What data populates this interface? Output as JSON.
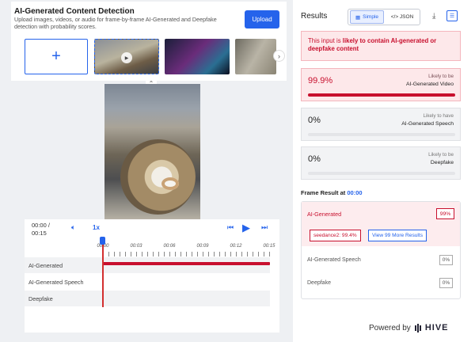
{
  "header": {
    "title": "AI-Generated Content Detection",
    "subtitle": "Upload images, videos, or audio for frame-by-frame AI-Generated and Deepfake detection with probability scores.",
    "upload_label": "Upload"
  },
  "thumbnails": {
    "add_label": "+"
  },
  "player": {
    "time_current": "00:00 /",
    "time_total": "00:15",
    "speed": "1x",
    "ticks": [
      "00:00",
      "00:03",
      "00:06",
      "00:09",
      "00:12",
      "00:15"
    ],
    "tracks": [
      "AI-Generated",
      "AI-Generated Speech",
      "Deepfake"
    ]
  },
  "results": {
    "title": "Results",
    "view_simple": "Simple",
    "view_json": "</> JSON",
    "alert_prefix": "This input is ",
    "alert_strong": "likely to contain AI-generated or deepfake content",
    "cards": [
      {
        "value": "99.9%",
        "sub": "Likely to be",
        "type": "AI-Generated Video",
        "fill": 0.999
      },
      {
        "value": "0%",
        "sub": "Likely to have",
        "type": "AI-Generated Speech",
        "fill": 0
      },
      {
        "value": "0%",
        "sub": "Likely to be",
        "type": "Deepfake",
        "fill": 0
      }
    ]
  },
  "frame": {
    "title_prefix": "Frame Result at ",
    "time": "00:00",
    "ai_label": "AI-Generated",
    "ai_value": "99%",
    "model_tag": "seedance2: 99.4%",
    "more_button": "View 99 More Results",
    "speech_label": "AI-Generated Speech",
    "speech_value": "0%",
    "deepfake_label": "Deepfake",
    "deepfake_value": "0%"
  },
  "footer": {
    "powered_by": "Powered by",
    "brand": "HIVE"
  },
  "colors": {
    "accent": "#2563eb",
    "danger": "#c8102e",
    "danger_bg": "#fde8ea"
  }
}
